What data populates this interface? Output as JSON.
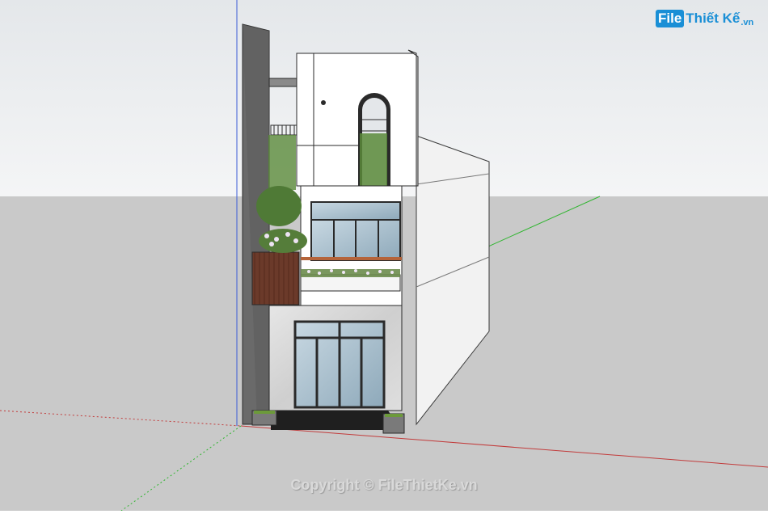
{
  "watermark_logo": {
    "box": "File",
    "text": "Thiết Kế",
    "suffix": ".vn"
  },
  "copyright": "Copyright © FileThietKe.vn",
  "colors": {
    "sky_top": "#e6e9ec",
    "ground": "#c9c9c9",
    "axis_red": "#c23b3b",
    "axis_green": "#2fb52f",
    "wall_white": "#ffffff",
    "wall_gray": "#5f5f5f",
    "wood": "#6b3a2a",
    "marble": "#d6d6d6",
    "glass": "#9fb9c8",
    "frame": "#3a3a3a"
  },
  "icons": [
    "sketchup-3d-scene"
  ]
}
